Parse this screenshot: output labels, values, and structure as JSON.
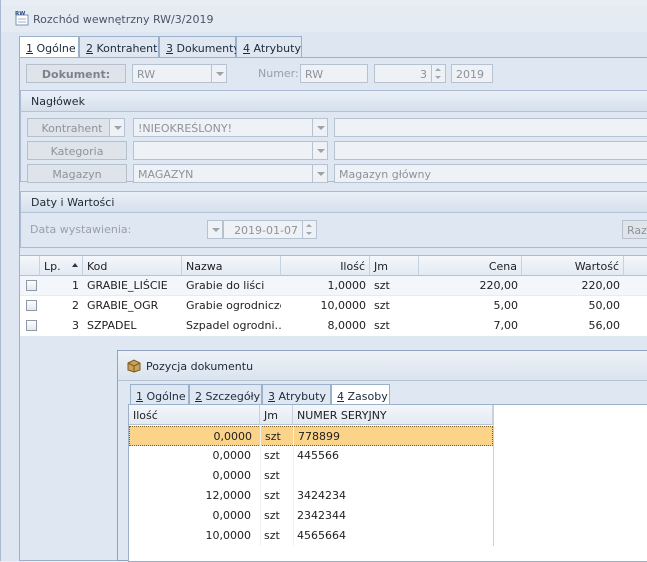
{
  "window": {
    "title": "Rozchód wewnętrzny RW/3/2019",
    "icon_label": "RW"
  },
  "tabs": [
    {
      "num": "1",
      "label": " Ogólne"
    },
    {
      "num": "2",
      "label": " Kontrahent"
    },
    {
      "num": "3",
      "label": " Dokumenty"
    },
    {
      "num": "4",
      "label": " Atrybuty"
    }
  ],
  "document": {
    "label": "Dokument:",
    "type_value": "RW",
    "number_label": "Numer:",
    "number_prefix": "RW",
    "number_seq": "3",
    "number_year": "2019"
  },
  "naglowek": {
    "title": "Nagłówek",
    "kontrahent_label": "Kontrahent",
    "kontrahent_value": "!NIEOKREŚLONY!",
    "kategoria_label": "Kategoria",
    "kategoria_value": "",
    "magazyn_label": "Magazyn",
    "magazyn_value": "MAGAZYN",
    "magazyn_name": "Magazyn główny"
  },
  "daty": {
    "title": "Daty i Wartości",
    "issue_label": "Data wystawienia:",
    "issue_value": "2019-01-07",
    "right_label": "Raze"
  },
  "items_table": {
    "headers": {
      "lp": "Lp.",
      "kod": "Kod",
      "nazwa": "Nazwa",
      "ilosc": "Ilość",
      "jm": "Jm",
      "cena": "Cena",
      "wartosc": "Wartość"
    },
    "rows": [
      {
        "lp": "1",
        "kod": "GRABIE_LIŚCIE",
        "nazwa": "Grabie do liści",
        "ilosc": "1,0000",
        "jm": "szt",
        "cena": "220,00",
        "wartosc": "220,00"
      },
      {
        "lp": "2",
        "kod": "GRABIE_OGR",
        "nazwa": "Grabie ogrodnicze",
        "ilosc": "10,0000",
        "jm": "szt",
        "cena": "5,00",
        "wartosc": "50,00"
      },
      {
        "lp": "3",
        "kod": "SZPADEL",
        "nazwa": "Szpadel ogrodni…",
        "ilosc": "8,0000",
        "jm": "szt",
        "cena": "7,00",
        "wartosc": "56,00"
      }
    ]
  },
  "pozycja": {
    "title": "Pozycja dokumentu",
    "tabs": [
      {
        "num": "1",
        "label": " Ogólne"
      },
      {
        "num": "2",
        "label": " Szczegóły"
      },
      {
        "num": "3",
        "label": " Atrybuty"
      },
      {
        "num": "4",
        "label": " Zasoby"
      }
    ],
    "headers": {
      "ilosc": "Ilość",
      "jm": "Jm",
      "serial": "NUMER SERYJNY"
    },
    "rows": [
      {
        "ilosc": "0,0000",
        "jm": "szt",
        "serial": "778899"
      },
      {
        "ilosc": "0,0000",
        "jm": "szt",
        "serial": "445566"
      },
      {
        "ilosc": "0,0000",
        "jm": "szt",
        "serial": ""
      },
      {
        "ilosc": "12,0000",
        "jm": "szt",
        "serial": "3424234"
      },
      {
        "ilosc": "0,0000",
        "jm": "szt",
        "serial": "2342344"
      },
      {
        "ilosc": "10,0000",
        "jm": "szt",
        "serial": "4565664"
      }
    ]
  }
}
